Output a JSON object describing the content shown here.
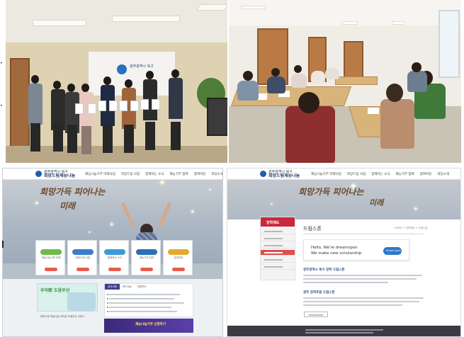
{
  "site": {
    "name_small": "광주광역시 북구",
    "name_big": "희망드림재능나눔",
    "nav": [
      "재능나눔기부 미래사업",
      "희망드림 사업",
      "함께하는 소식",
      "재능기부 참여",
      "참여마당",
      "희망소개"
    ]
  },
  "main_page": {
    "hero_title_line1": "희망가득 피어나는",
    "hero_title_line2": "미래",
    "cards": [
      {
        "label": "재능나눔기부 미래",
        "color": "#6dbb4e"
      },
      {
        "label": "희망드림 사업",
        "color": "#3d7cc9"
      },
      {
        "label": "함께하는 소식",
        "color": "#3c9bd6"
      },
      {
        "label": "재능기부 참여",
        "color": "#2d6fb8"
      },
      {
        "label": "참여마당",
        "color": "#e3a933"
      }
    ],
    "promo_title": "우리家 도움우산",
    "promo_caption": "희망드림 재능나눔 우리집 도움우산 서비스",
    "news_tabs": [
      "공지사항",
      "보도자료",
      "언론보도"
    ],
    "banner_text": "재능나눔기부 신청하기"
  },
  "sub_page": {
    "sidebar_title": "장학제도",
    "page_title": "드림스폰",
    "breadcrumb": "HOME > 장학제도 > 드림스폰",
    "promo_line1": "Hello, We're dreamspon",
    "promo_line2": "We make new scholarship",
    "promo_badge": "dream spon",
    "section1": "광주광역시 북구 장학 드림스폰",
    "section2": "광주 장학후원 드림스폰"
  },
  "photo": {
    "banner_org": "광주광역시 북구"
  }
}
